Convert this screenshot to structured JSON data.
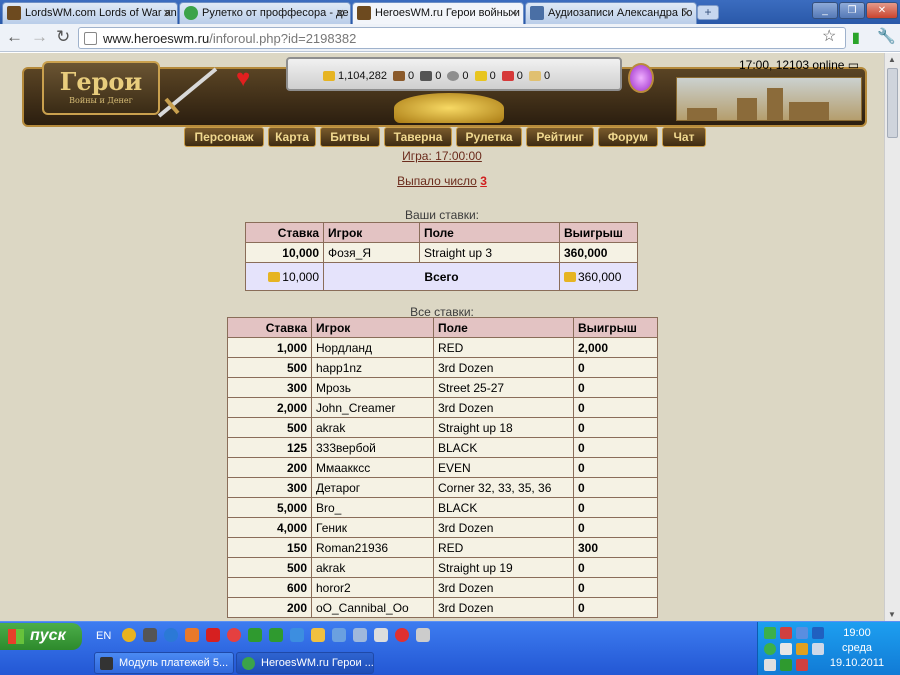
{
  "browser": {
    "tabs": [
      {
        "title": "LordsWM.com Lords of War an",
        "icon_color": "#6d4a1f"
      },
      {
        "title": "Рулетко от проффесора - де",
        "icon_color": "#3ba34a"
      },
      {
        "title": "HeroesWM.ru Герои войны и",
        "icon_color": "#6d4a1f"
      },
      {
        "title": "Аудиозаписи Александра Го",
        "icon_color": "#4a6fa5"
      }
    ],
    "new_tab": "+",
    "window_buttons": [
      "_",
      "❐",
      "✕"
    ],
    "url_host": "www.heroeswm.ru",
    "url_path": "/inforoul.php?id=2198382",
    "nav_icons": [
      "back-icon",
      "forward-icon",
      "reload-icon",
      "star-icon",
      "wrench-icon"
    ]
  },
  "game": {
    "logo": "Герои",
    "logo_sub": "Войны и Денег",
    "resources": [
      "1,104,282",
      "0",
      "0",
      "0",
      "0",
      "0",
      "0"
    ],
    "resource_icons": [
      "gold-icon",
      "wood-icon",
      "ore-icon",
      "mercury-icon",
      "sulfur-icon",
      "crystal-icon",
      "gems-icon"
    ],
    "online": "17:00, 12103 online",
    "menu": [
      "Персонаж",
      "Карта",
      "Битвы",
      "Таверна",
      "Рулетка",
      "Рейтинг",
      "Форум",
      "Чат"
    ]
  },
  "roulette": {
    "game_link": "Игра: 17:00:00",
    "result_label": "Выпало число",
    "result_number": "3",
    "my_bets_title": "Ваши ставки:",
    "all_bets_title": "Все ставки:",
    "columns": [
      "Ставка",
      "Игрок",
      "Поле",
      "Выигрыш"
    ],
    "my_bets": [
      {
        "bet": "10,000",
        "player": "Фозя_Я",
        "field": "Straight up 3",
        "win": "360,000"
      }
    ],
    "totals": {
      "bet": "10,000",
      "label": "Всего",
      "win": "360,000"
    },
    "all_bets": [
      {
        "bet": "1,000",
        "player": "Нордланд",
        "field": "RED",
        "win": "2,000"
      },
      {
        "bet": "500",
        "player": "happ1nz",
        "field": "3rd Dozen",
        "win": "0"
      },
      {
        "bet": "300",
        "player": "Мрозь",
        "field": "Street 25-27",
        "win": "0"
      },
      {
        "bet": "2,000",
        "player": "John_Creamer",
        "field": "3rd Dozen",
        "win": "0"
      },
      {
        "bet": "500",
        "player": "akrak",
        "field": "Straight up 18",
        "win": "0"
      },
      {
        "bet": "125",
        "player": "333вербой",
        "field": "BLACK",
        "win": "0"
      },
      {
        "bet": "200",
        "player": "Ммаакксс",
        "field": "EVEN",
        "win": "0"
      },
      {
        "bet": "300",
        "player": "Детарог",
        "field": "Corner 32, 33, 35, 36",
        "win": "0"
      },
      {
        "bet": "5,000",
        "player": "Bro_",
        "field": "BLACK",
        "win": "0"
      },
      {
        "bet": "4,000",
        "player": "Геник",
        "field": "3rd Dozen",
        "win": "0"
      },
      {
        "bet": "150",
        "player": "Roman21936",
        "field": "RED",
        "win": "300"
      },
      {
        "bet": "500",
        "player": "akrak",
        "field": "Straight up 19",
        "win": "0"
      },
      {
        "bet": "600",
        "player": "horor2",
        "field": "3rd Dozen",
        "win": "0"
      },
      {
        "bet": "200",
        "player": "oO_Cannibal_Oo",
        "field": "3rd Dozen",
        "win": "0"
      }
    ]
  },
  "taskbar": {
    "start_label": "пуск",
    "lang": "EN",
    "tasks": [
      {
        "title": "Модуль платежей 5...",
        "icon_color": "#333"
      },
      {
        "title": "HeroesWM.ru Герои ...",
        "icon_color": "#3ba34a"
      }
    ],
    "clock_time": "19:00",
    "clock_day": "среда",
    "clock_date": "19.10.2011"
  }
}
